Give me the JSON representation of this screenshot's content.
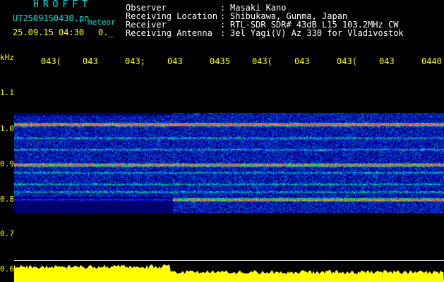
{
  "header": {
    "title": "HROFFT",
    "filename": "UT2509150430.pn",
    "file_type": "meteor",
    "datetime": "25.09.15 04:30",
    "code": "0._",
    "fields": [
      {
        "label": "Observer",
        "value": "Masaki Kano"
      },
      {
        "label": "Receiving Location",
        "value": "Shibukawa, Gunma, Japan"
      },
      {
        "label": "Receiver",
        "value": "RTL-SDR SDR# 43dB L15 103.2MHz CW"
      },
      {
        "label": "Receiving Antenna",
        "value": "3el Yagi(V) Az 330 for Vladivostok"
      }
    ],
    "colon": ":"
  },
  "axis": {
    "unit": "kHz",
    "y_ticks": [
      "1.1",
      "1.0",
      "0.9",
      "0.8",
      "0.7",
      "0.6"
    ],
    "y_tick_values": [
      1.1,
      1.0,
      0.9,
      0.8,
      0.7,
      0.6
    ],
    "x_ticks": [
      "043(",
      "043",
      "043;",
      "043",
      "0435",
      "043(",
      "043",
      "043(",
      "043",
      "0440"
    ]
  },
  "colors": {
    "background": "#000000",
    "label_yellow": "#ffff00",
    "header_cyan": "#00e6e6",
    "spectrum_fill": "#ffff00"
  },
  "spectrogram": {
    "freq_range_khz": [
      0.76,
      1.02
    ],
    "strong_bands_khz": [
      0.99,
      0.885,
      0.795
    ],
    "weak_bands_khz": [
      0.955,
      0.925,
      0.865,
      0.835,
      0.815
    ]
  }
}
